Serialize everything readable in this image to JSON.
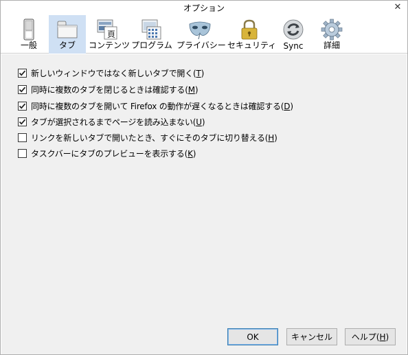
{
  "window": {
    "title": "オプション"
  },
  "toolbar": {
    "items": [
      {
        "label": "一般",
        "icon": "switch-icon"
      },
      {
        "label": "タブ",
        "icon": "tabs-icon"
      },
      {
        "label": "コンテンツ",
        "icon": "content-icon"
      },
      {
        "label": "プログラム",
        "icon": "applications-icon"
      },
      {
        "label": "プライバシー",
        "icon": "mask-icon"
      },
      {
        "label": "セキュリティ",
        "icon": "padlock-icon"
      },
      {
        "label": "Sync",
        "icon": "sync-icon"
      },
      {
        "label": "詳細",
        "icon": "gear-icon"
      }
    ],
    "selected": "タブ"
  },
  "options": [
    {
      "text": "新しいウィンドウではなく新しいタブで開く(",
      "key": "T",
      "end": ")",
      "checked": true
    },
    {
      "text": "同時に複数のタブを閉じるときは確認する(",
      "key": "M",
      "end": ")",
      "checked": true
    },
    {
      "text": "同時に複数のタブを開いて Firefox の動作が遅くなるときは確認する(",
      "key": "D",
      "end": ")",
      "checked": true
    },
    {
      "text": "タブが選択されるまでページを読み込まない(",
      "key": "U",
      "end": ")",
      "checked": true
    },
    {
      "text": "リンクを新しいタブで開いたとき、すぐにそのタブに切り替える(",
      "key": "H",
      "end": ")",
      "checked": false
    },
    {
      "text": "タスクバーにタブのプレビューを表示する(",
      "key": "K",
      "end": ")",
      "checked": false
    }
  ],
  "buttons": {
    "ok": "OK",
    "cancel": "キャンセル",
    "help_text": "ヘルプ(",
    "help_key": "H",
    "help_end": ")"
  },
  "colors": {
    "selected_tab_bg": "#cfe0f4",
    "content_bg": "#f0f0f0",
    "default_button_border": "#3c7fb1"
  }
}
